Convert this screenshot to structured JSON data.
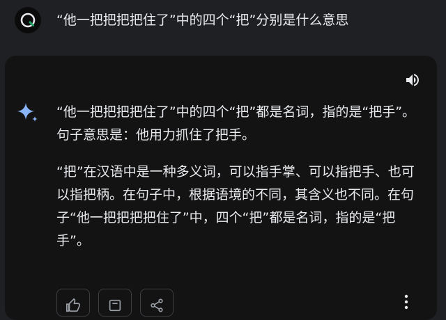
{
  "prompt": {
    "text": "“他一把把把把住了”中的四个“把”分别是什么意思"
  },
  "response": {
    "paragraphs": [
      "“他一把把把把住了”中的四个“把”都是名词，指的是“把手”。句子意思是：他用力抓住了把手。",
      "“把”在汉语中是一种多义词，可以指手掌、可以指把手、也可以指把柄。在句子中，根据语境的不同，其含义也不同。在句子“他一把把把把住了”中，四个“把”都是名词，指的是“把手”。"
    ]
  },
  "icons": {
    "avatar": "user-avatar-icon",
    "speaker": "speaker-icon",
    "assistant": "sparkle-icon",
    "actions": [
      "thumb-up-icon",
      "modify-icon",
      "share-icon",
      "more-vert-icon"
    ]
  },
  "colors": {
    "page_background": "#1f2023",
    "card_background": "#131314",
    "text": "#e8eaed",
    "sparkle_blue": "#8ab4f8",
    "avatar_accent": "#1ea362"
  }
}
